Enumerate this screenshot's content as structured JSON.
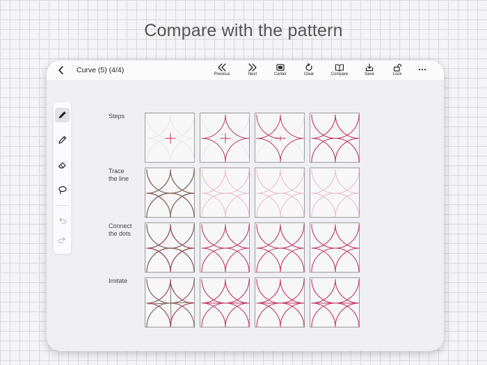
{
  "headline": "Compare with the pattern",
  "toolbar": {
    "title": "Curve (5) (4/4)",
    "tools": [
      {
        "id": "previous",
        "label": "Previous",
        "icon": "double-chevron-left-icon"
      },
      {
        "id": "next",
        "label": "Next",
        "icon": "double-chevron-right-icon"
      },
      {
        "id": "center",
        "label": "Center",
        "icon": "center-frame-icon"
      },
      {
        "id": "clear",
        "label": "Clear",
        "icon": "refresh-icon"
      },
      {
        "id": "compare",
        "label": "Compare",
        "icon": "open-book-icon"
      },
      {
        "id": "save",
        "label": "Save",
        "icon": "save-tray-icon"
      },
      {
        "id": "lock",
        "label": "Lock",
        "icon": "unlock-icon"
      }
    ],
    "more_icon": "ellipsis-icon"
  },
  "palette": {
    "tools": [
      "pen-icon",
      "pencil-icon",
      "eraser-icon",
      "lasso-icon"
    ],
    "active": "pen-icon",
    "history": [
      "undo-icon",
      "redo-icon"
    ]
  },
  "rows": [
    {
      "label": "Steps"
    },
    {
      "label": "Trace\nthe line"
    },
    {
      "label": "Connect\nthe dots"
    },
    {
      "label": "Imitate"
    }
  ],
  "colors": {
    "accent": "#c0355f",
    "guide": "#e6b9c8",
    "faint": "#e9e6ea",
    "user_stroke": "#8a6f66"
  }
}
